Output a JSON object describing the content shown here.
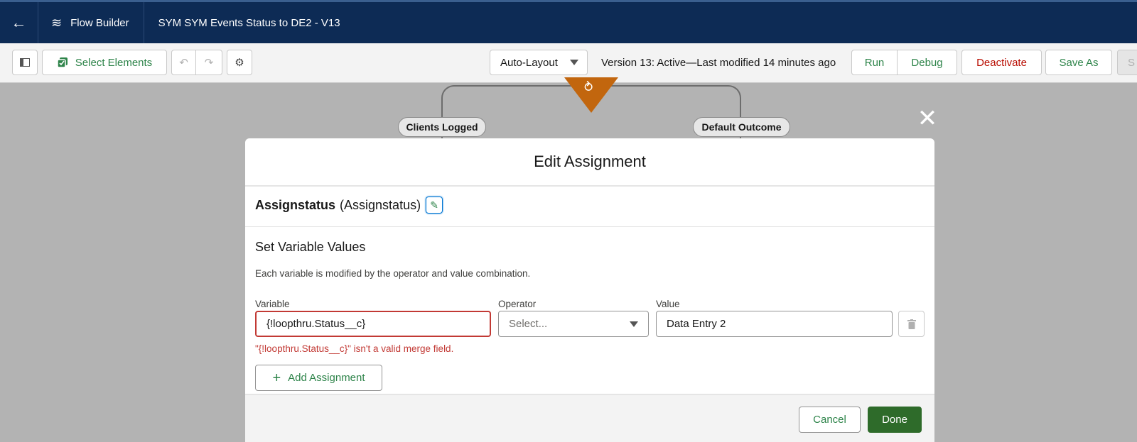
{
  "header": {
    "back_icon": "arrow-left-icon",
    "app_icon": "flow-icon",
    "app_name": "Flow Builder",
    "flow_title": "SYM SYM Events Status to DE2 - V13"
  },
  "toolbar": {
    "toggle_panel_icon": "panel-toggle-icon",
    "select_elements_label": "Select Elements",
    "undo_icon": "undo-icon",
    "redo_icon": "redo-icon",
    "settings_icon": "gear-icon",
    "layout_label": "Auto-Layout",
    "version_status": "Version 13: Active—Last modified 14 minutes ago",
    "run_label": "Run",
    "debug_label": "Debug",
    "deactivate_label": "Deactivate",
    "save_as_label": "Save As",
    "save_label": "S"
  },
  "canvas": {
    "left_outcome": "Clients Logged",
    "right_outcome": "Default Outcome"
  },
  "modal": {
    "title": "Edit Assignment",
    "element_label": "Assignstatus",
    "element_api_name": "(Assignstatus)",
    "section_title": "Set Variable Values",
    "section_description": "Each variable is modified by the operator and value combination.",
    "columns": {
      "variable": "Variable",
      "operator": "Operator",
      "value": "Value"
    },
    "row": {
      "variable_value": "{!loopthru.Status__c}",
      "operator_placeholder": "Select...",
      "value_value": "Data Entry 2",
      "error_message": "\"{!loopthru.Status__c}\" isn't a valid merge field."
    },
    "add_assignment_label": "Add Assignment",
    "cancel_label": "Cancel",
    "done_label": "Done"
  },
  "colors": {
    "header_bg": "#0d2b55",
    "brand_green": "#2e844a",
    "done_bg": "#2e6b2a",
    "error_red": "#c23934",
    "decision_orange": "#c2660e"
  }
}
